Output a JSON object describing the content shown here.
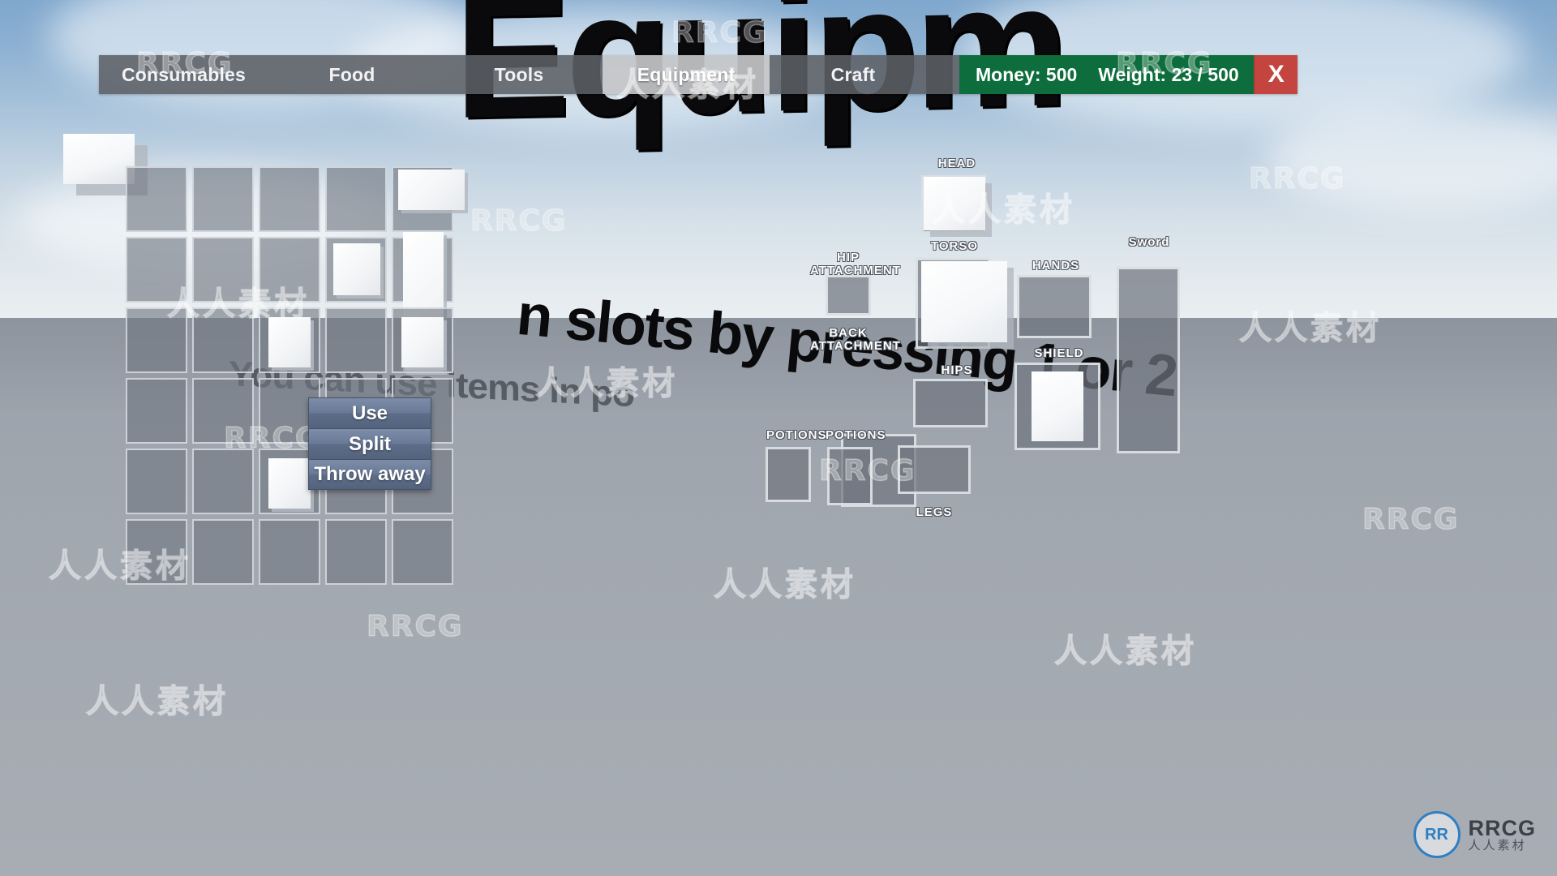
{
  "window": {
    "world_title": "Equipm",
    "world_hint_far": "You can use items in po",
    "world_hint_near": "n slots by pressing 1 or 2"
  },
  "tabbar": {
    "tabs": [
      {
        "label": "Consumables",
        "active": false
      },
      {
        "label": "Food",
        "active": false
      },
      {
        "label": "Tools",
        "active": false
      },
      {
        "label": "Equipment",
        "active": true
      },
      {
        "label": "Craft",
        "active": false
      }
    ],
    "stats": {
      "money": "Money: 500",
      "weight": "Weight: 23 / 500"
    },
    "close_label": "X",
    "colors": {
      "tab_bg": "#5c6065",
      "tab_active_bg": "#c4c6c8",
      "stats_bg": "#0d6d3c",
      "close_bg": "#c4453f"
    }
  },
  "inventory": {
    "columns": 5,
    "rows": 6,
    "slots": [
      {
        "index": 0,
        "item": null
      },
      {
        "index": 1,
        "item": null
      },
      {
        "index": 2,
        "item": null
      },
      {
        "index": 3,
        "item": null
      },
      {
        "index": 4,
        "item": "wide"
      },
      {
        "index": 5,
        "item": null
      },
      {
        "index": 6,
        "item": null
      },
      {
        "index": 7,
        "item": null
      },
      {
        "index": 8,
        "item": "cube"
      },
      {
        "index": 9,
        "item": "tall"
      },
      {
        "index": 10,
        "item": null
      },
      {
        "index": 11,
        "item": null
      },
      {
        "index": 12,
        "item": "small"
      },
      {
        "index": 13,
        "item": null
      },
      {
        "index": 14,
        "item": "small"
      },
      {
        "index": 15,
        "item": null
      },
      {
        "index": 16,
        "item": null
      },
      {
        "index": 17,
        "item": null
      },
      {
        "index": 18,
        "item": null
      },
      {
        "index": 19,
        "item": null
      },
      {
        "index": 20,
        "item": null
      },
      {
        "index": 21,
        "item": null
      },
      {
        "index": 22,
        "item": "small"
      },
      {
        "index": 23,
        "item": null
      },
      {
        "index": 24,
        "item": null
      },
      {
        "index": 25,
        "item": null
      },
      {
        "index": 26,
        "item": null
      },
      {
        "index": 27,
        "item": null
      },
      {
        "index": 28,
        "item": null
      },
      {
        "index": 29,
        "item": null
      }
    ]
  },
  "context_menu": {
    "items": [
      {
        "label": "Use"
      },
      {
        "label": "Split"
      },
      {
        "label": "Throw away"
      }
    ]
  },
  "equipment": {
    "slots": [
      {
        "name": "head",
        "label": "HEAD",
        "filled": true
      },
      {
        "name": "torso",
        "label": "TORSO",
        "filled": true
      },
      {
        "name": "hip-attachment",
        "label": "HIP\nATTACHMENT",
        "filled": false
      },
      {
        "name": "back-attachment",
        "label": "BACK\nATTACHMENT",
        "filled": false
      },
      {
        "name": "hands",
        "label": "HANDS",
        "filled": false
      },
      {
        "name": "shield",
        "label": "SHIELD",
        "filled": true
      },
      {
        "name": "sword",
        "label": "Sword",
        "filled": false
      },
      {
        "name": "hips",
        "label": "HIPS",
        "filled": false
      },
      {
        "name": "potions-1",
        "label": "POTIONS",
        "filled": false
      },
      {
        "name": "potions-2",
        "label": "POTIONS",
        "filled": false
      },
      {
        "name": "legs",
        "label": "LEGS",
        "filled": false
      }
    ]
  },
  "watermarks": {
    "rrcg": "RRCG",
    "cn": "人人素材",
    "logo_badge": "RR",
    "logo_top": "RRCG",
    "logo_bottom": "人人素材"
  }
}
